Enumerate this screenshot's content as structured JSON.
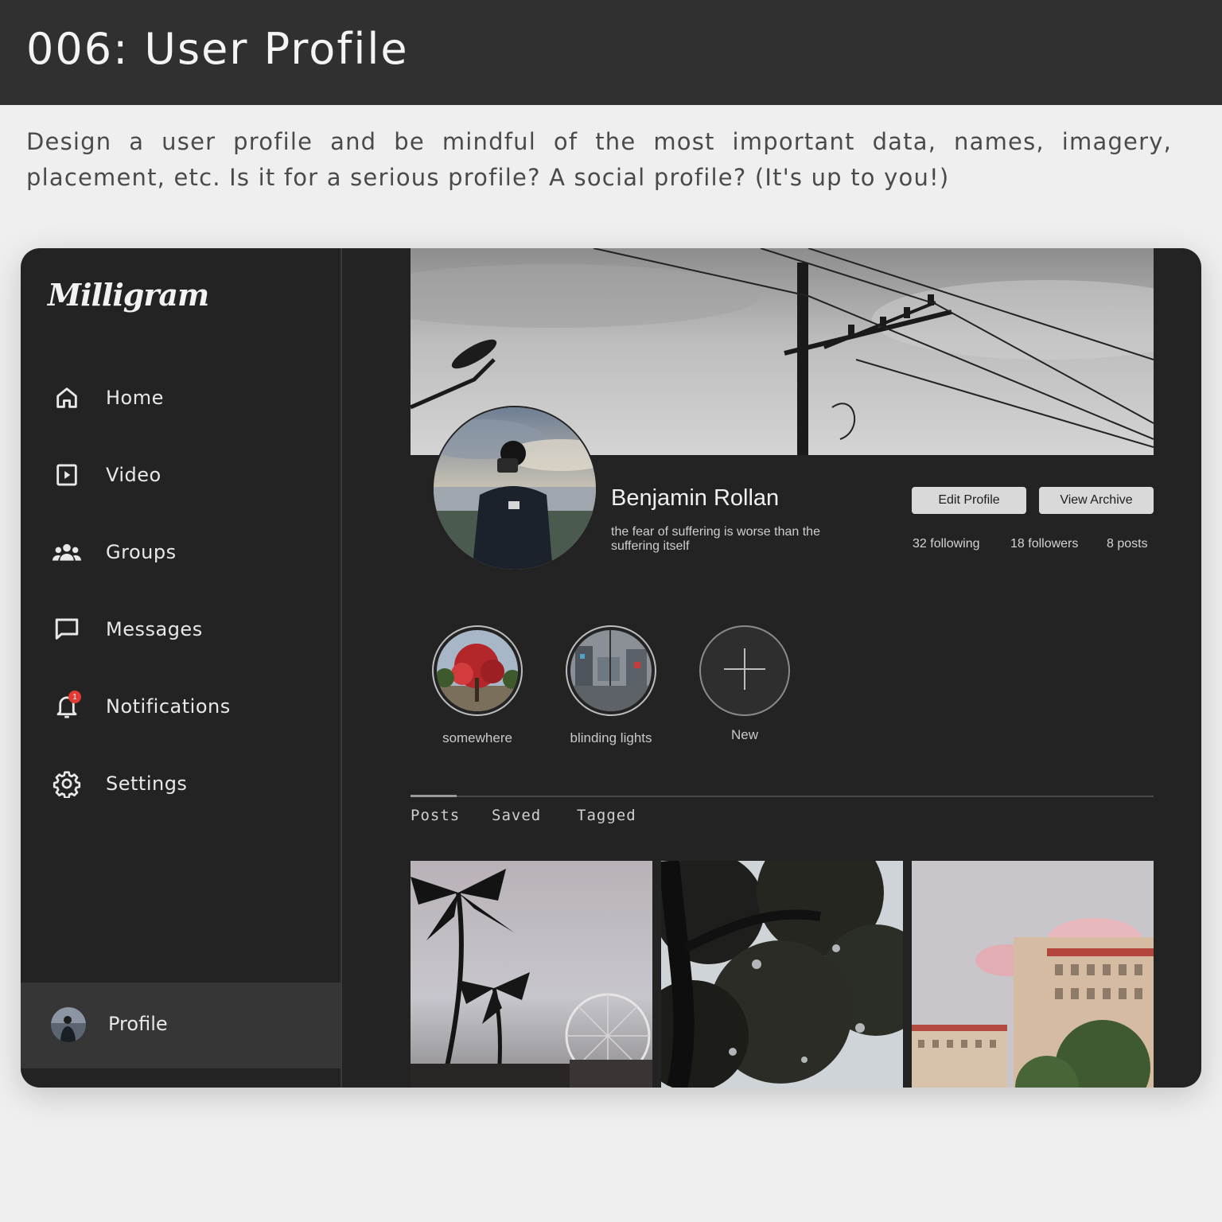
{
  "header": {
    "title": "006: User Profile"
  },
  "brief": {
    "text": "Design a user profile and be mindful of the most important data, names, imagery, placement, etc. Is it for a serious profile? A social profile? (It's up to you!)"
  },
  "app": {
    "logo": "Milligram",
    "nav": [
      {
        "label": "Home",
        "icon": "home-icon"
      },
      {
        "label": "Video",
        "icon": "video-icon"
      },
      {
        "label": "Groups",
        "icon": "groups-icon"
      },
      {
        "label": "Messages",
        "icon": "message-icon"
      },
      {
        "label": "Notifications",
        "icon": "bell-icon",
        "badge": "1"
      },
      {
        "label": "Settings",
        "icon": "gear-icon"
      }
    ],
    "profile_nav": {
      "label": "Profile"
    }
  },
  "profile": {
    "name": "Benjamin Rollan",
    "bio": "the fear of suffering is worse than the suffering itself",
    "edit_button": "Edit Profile",
    "archive_button": "View Archive",
    "stats": {
      "following": "32 following",
      "followers": "18 followers",
      "posts": "8 posts"
    }
  },
  "highlights": [
    {
      "label": "somewhere"
    },
    {
      "label": "blinding lights"
    },
    {
      "label": "New"
    }
  ],
  "tabs": [
    "Posts",
    "Saved",
    "Tagged"
  ],
  "colors": {
    "background": "#232323",
    "accent": "#d9d9d9",
    "badge": "#e53935"
  }
}
